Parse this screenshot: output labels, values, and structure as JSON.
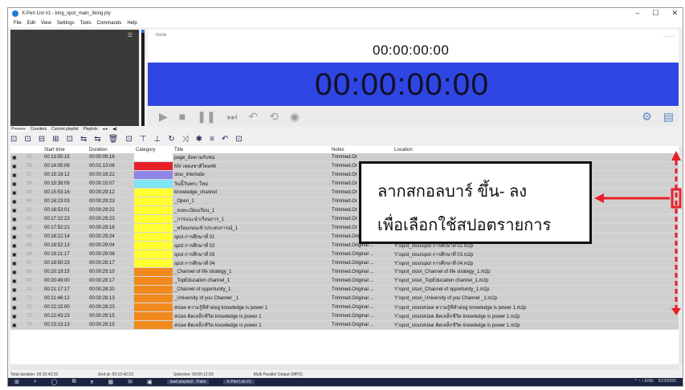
{
  "window": {
    "title": "X-Pert List #1 - king_spot_main_3king.ply",
    "controls": [
      "–",
      "☐",
      "✕"
    ]
  },
  "menu": [
    "File",
    "Edit",
    "View",
    "Settings",
    "Tools",
    "Commands",
    "Help"
  ],
  "preview": {
    "menu_glyph": "☰"
  },
  "clock": {
    "none_label": "none",
    "small_time": "00:00:00:00",
    "big_time": "00:00:00:00",
    "right_text": "--:--:--"
  },
  "transport_icons": [
    "play-icon",
    "stop-icon",
    "pause-icon",
    "skip-icon",
    "undo-icon",
    "loop-icon",
    "globe-icon"
  ],
  "transport_glyphs": [
    "▶",
    "■",
    "❚❚",
    "⏭",
    "↶",
    "⟲",
    "◉"
  ],
  "right_icons_glyphs": [
    "⚙",
    "▤"
  ],
  "tabs": [
    "Preview",
    "Counters",
    "Current playlist",
    "Playlists",
    "◂ ▸",
    "◀)"
  ],
  "toolbar_glyphs": [
    "⊡",
    "⊡",
    "⊟",
    "⊞",
    "⊡",
    "⇆",
    "⇆",
    "🗑",
    "⊡",
    "⊤",
    "⊥",
    "↻",
    "⤨",
    "✱",
    "≡",
    "↶",
    "⊡"
  ],
  "columns": [
    "",
    "",
    "Start time",
    "Duration",
    "Category",
    "Title",
    "Notes",
    "Location"
  ],
  "rows": [
    {
      "n": "55",
      "start": "00:13:55:15",
      "dur": "00:00:09:16",
      "cat": "#ffffff",
      "title": "page_อัลตามกับชม",
      "notes": "Trimmed.Or",
      "loc": ""
    },
    {
      "n": "56",
      "start": "00:14:05:06",
      "dur": "00:01:13:06",
      "cat": "#e8202a",
      "title": "MV เพลงชาติไทย4K",
      "notes": "Trimmed.Or",
      "loc": ""
    },
    {
      "n": "57",
      "start": "00:15:18:12",
      "dur": "00:00:19:22",
      "cat": "#8e86e6",
      "title": "stou_interlude",
      "notes": "Trimmed.Or",
      "loc": ""
    },
    {
      "n": "58",
      "start": "00:15:38:09",
      "dur": "00:00:15:07",
      "cat": "#7fe4f4",
      "title": "วันนี้วันพระ ใหม่",
      "notes": "Trimmed.Or",
      "loc": ""
    },
    {
      "n": "59",
      "start": "00:15:53:16",
      "dur": "00:00:29:12",
      "cat": "#ffff33",
      "title": "knowledge_channel",
      "notes": "Trimmed.Or",
      "loc": ""
    },
    {
      "n": "60",
      "start": "00:16:23:03",
      "dur": "00:00:29:23",
      "cat": "#ffff33",
      "title": "_Open_1",
      "notes": "Trimmed.Or",
      "loc": ""
    },
    {
      "n": "61",
      "start": "00:16:53:01",
      "dur": "00:00:29:22",
      "cat": "#ffff33",
      "title": "_ลงทะเบียนเรียน_1",
      "notes": "Trimmed.Or",
      "loc": ""
    },
    {
      "n": "62",
      "start": "00:17:22:23",
      "dur": "00:00:29:23",
      "cat": "#ffff33",
      "title": "_การแนะนำเรียนการ_1",
      "notes": "Trimmed.Or",
      "loc": ""
    },
    {
      "n": "63",
      "start": "00:17:52:21",
      "dur": "00:00:29:18",
      "cat": "#ffff33",
      "title": "_พร้อมก่อนเข้าประสบการณ์_1",
      "notes": "Trimmed.Or",
      "loc": ""
    },
    {
      "n": "64",
      "start": "00:18:22:14",
      "dur": "00:00:29:24",
      "cat": "#ffff33",
      "title": "spot การศึกษาที่ 01",
      "notes": "Trimmed.Original ...",
      "loc": "Y:\\spot_stou\\spot การศึกษาที่ 01.m2p"
    },
    {
      "n": "65",
      "start": "00:18:52:13",
      "dur": "00:00:29:04",
      "cat": "#ffff33",
      "title": "spot การศึกษาที่ 02",
      "notes": "Trimmed.Original ...",
      "loc": "Y:\\spot_stou\\spot การศึกษาที่ 02.m2p"
    },
    {
      "n": "66",
      "start": "00:19:21:17",
      "dur": "00:00:29:06",
      "cat": "#ffff33",
      "title": "spot การศึกษาที่ 03",
      "notes": "Trimmed.Original ...",
      "loc": "Y:\\spot_stou\\spot การศึกษาที่ 03.m2p"
    },
    {
      "n": "67",
      "start": "00:19:50:23",
      "dur": "00:00:28:17",
      "cat": "#ffff33",
      "title": "spot การศึกษาที่ 04",
      "notes": "Trimmed.Original ...",
      "loc": "Y:\\spot_stou\\spot การศึกษาที่ 04.m2p"
    },
    {
      "n": "68",
      "start": "00:20:19:15",
      "dur": "00:00:29:10",
      "cat": "#f08a1e",
      "title": "_Channel of life strategy_1",
      "notes": "Trimmed.Original ...",
      "loc": "Y:\\spot_stou\\_Channel of life strategy_1.m2p"
    },
    {
      "n": "69",
      "start": "00:20:49:00",
      "dur": "00:00:28:17",
      "cat": "#f08a1e",
      "title": "_TopEducation channel_1",
      "notes": "Trimmed.Original ...",
      "loc": "Y:\\spot_stou\\_TopEducation channel_1.m2p"
    },
    {
      "n": "70",
      "start": "00:21:17:17",
      "dur": "00:00:28:20",
      "cat": "#f08a1e",
      "title": "_Channel of opportunity_1",
      "notes": "Trimmed.Original ...",
      "loc": "Y:\\spot_stou\\_Channel of opportunity_1.m2p"
    },
    {
      "n": "71",
      "start": "00:21:46:12",
      "dur": "00:00:28:13",
      "cat": "#f08a1e",
      "title": "_University of you Channel _1",
      "notes": "Trimmed.Original ...",
      "loc": "Y:\\spot_stou\\_University of you Channel _1.m2p"
    },
    {
      "n": "72",
      "start": "00:22:15:00",
      "dur": "00:00:28:23",
      "cat": "#f08a1e",
      "title": "สปอต ความรู้ที่ทำต่อยู่ knowledge is power 1",
      "notes": "Trimmed.Original ...",
      "loc": "Y:\\spot_stou\\สปอต ความรู้ที่ทำต่อยู่ knowledge is power 1.m2p"
    },
    {
      "n": "73",
      "start": "00:22:43:23",
      "dur": "00:00:29:15",
      "cat": "#f08a1e",
      "title": "สปอต ติดเหล็กชีวิต knowledge is power 1",
      "notes": "Trimmed.Original ...",
      "loc": "Y:\\spot_stou\\สปอต ติดเหล็กชีวิต knowledge is power 1.m2p"
    },
    {
      "n": "74",
      "start": "00:23:13:13",
      "dur": "00:00:29:15",
      "cat": "#f08a1e",
      "title": "สปอต ติดเหล็กชีวิต knowledge is power 1",
      "notes": "Trimmed.Original ...",
      "loc": "Y:\\spot_stou\\สปอต ติดเหล็กชีวิต knowledge is power 1.m2p"
    }
  ],
  "status": {
    "total": "Total duration: 00:10:42:23",
    "end_at": "End at: 00:10:42:23",
    "selection": "Selection: 00:00:12:03",
    "output": "Multi Parallel Output (MPO)"
  },
  "taskbar": {
    "items": [
      "⊞",
      "⌕",
      "◯",
      "⧉",
      "e",
      "▦",
      "✉",
      "▣"
    ],
    "app1": "load playlist2 - Paint",
    "app2": "X-Pert List #1",
    "tray": "^ ◔ ♪ ENG",
    "date": "5/13/2020"
  },
  "callout": {
    "line1": "ลากสกอลบาร์ ขึ้น- ลง",
    "line2": "เพื่อเลือกใช้สปอตรายการ"
  },
  "annotation_color": "#e8202a"
}
